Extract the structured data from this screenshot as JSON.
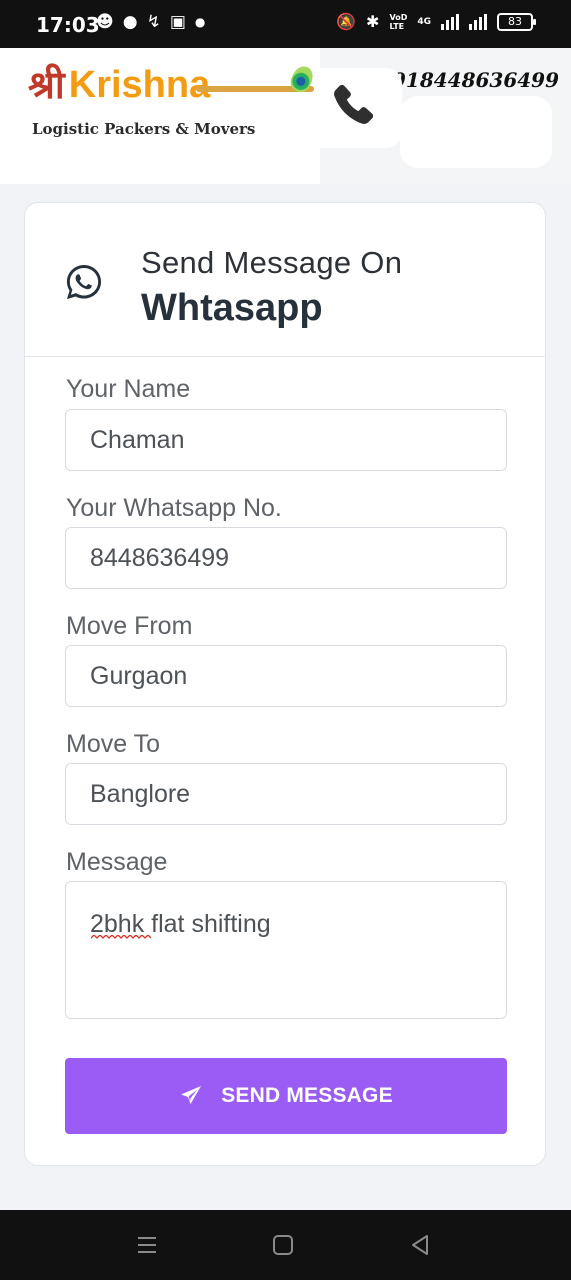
{
  "status_bar": {
    "time": "17:03",
    "left_icons": [
      "snapchat-icon",
      "chat-bubble-icon",
      "activity-icon",
      "instagram-icon",
      "dot-icon"
    ],
    "network_label_top": "VoD",
    "network_label_bottom": "LTE",
    "network_type": "4G",
    "battery": "83"
  },
  "header": {
    "logo_shri": "श्री",
    "logo_krishna": "Krishna",
    "logo_tagline": "Logistic Packers & Movers",
    "phone_number": "918448636499",
    "phone_icon": "phone-handset-icon"
  },
  "form": {
    "heading_line1": "Send Message On",
    "heading_line2": "Whtasapp",
    "heading_icon": "whatsapp-icon",
    "fields": [
      {
        "label": "Your Name",
        "value": "Chaman"
      },
      {
        "label": "Your Whatsapp No.",
        "value": "8448636499"
      },
      {
        "label": "Move From",
        "value": "Gurgaon"
      },
      {
        "label": "Move To",
        "value": "Banglore"
      }
    ],
    "message": {
      "label": "Message",
      "value": "2bhk flat shifting"
    },
    "submit_label": "SEND MESSAGE",
    "submit_icon": "paper-plane-icon",
    "accent_color": "#9b5cf6"
  },
  "nav_bar": {
    "buttons": [
      "menu-icon",
      "home-icon",
      "back-icon"
    ]
  }
}
